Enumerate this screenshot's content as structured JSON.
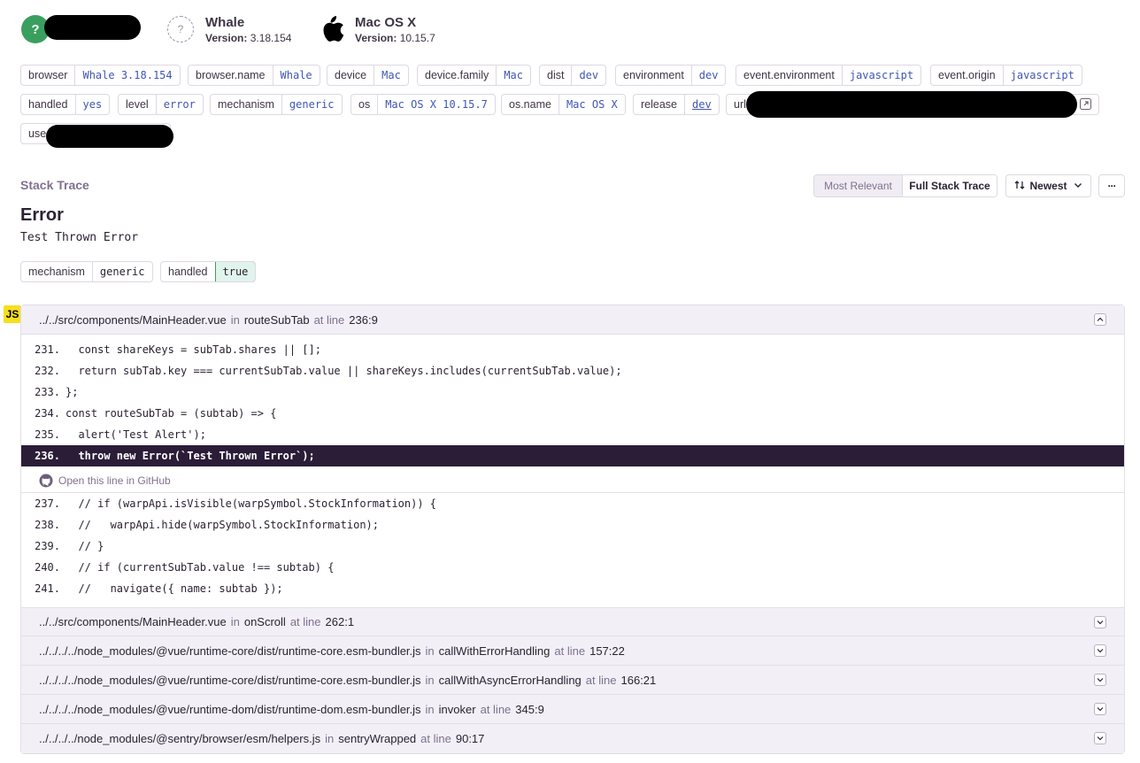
{
  "context": {
    "browser": {
      "title": "Whale",
      "version_label": "Version:",
      "version": "3.18.154"
    },
    "os": {
      "title": "Mac OS X",
      "version_label": "Version:",
      "version": "10.15.7"
    }
  },
  "tags": [
    {
      "key": "browser",
      "value": "Whale 3.18.154"
    },
    {
      "key": "browser.name",
      "value": "Whale"
    },
    {
      "key": "device",
      "value": "Mac"
    },
    {
      "key": "device.family",
      "value": "Mac"
    },
    {
      "key": "dist",
      "value": "dev"
    },
    {
      "key": "environment",
      "value": "dev"
    },
    {
      "key": "event.environment",
      "value": "javascript"
    },
    {
      "key": "event.origin",
      "value": "javascript"
    },
    {
      "key": "handled",
      "value": "yes"
    },
    {
      "key": "level",
      "value": "error"
    },
    {
      "key": "mechanism",
      "value": "generic"
    },
    {
      "key": "os",
      "value": "Mac OS X 10.15.7"
    },
    {
      "key": "os.name",
      "value": "Mac OS X"
    },
    {
      "key": "release",
      "value": "dev"
    },
    {
      "key": "url",
      "value": ""
    },
    {
      "key": "use",
      "value": ""
    }
  ],
  "stack": {
    "title": "Stack Trace",
    "toggle": {
      "relevant": "Most Relevant",
      "full": "Full Stack Trace"
    },
    "sort_label": "Newest",
    "more_label": "···"
  },
  "error": {
    "type": "Error",
    "message": "Test Thrown Error",
    "badges": [
      {
        "key": "mechanism",
        "value": "generic"
      },
      {
        "key": "handled",
        "value": "true"
      }
    ]
  },
  "platform_badge": "JS",
  "frames": [
    {
      "file": "../../src/components/MainHeader.vue",
      "in": "in",
      "fn": "routeSubTab",
      "at": "at line",
      "line": "236:9"
    },
    {
      "file": "../../src/components/MainHeader.vue",
      "in": "in",
      "fn": "onScroll",
      "at": "at line",
      "line": "262:1"
    },
    {
      "file": "../../../../node_modules/@vue/runtime-core/dist/runtime-core.esm-bundler.js",
      "in": "in",
      "fn": "callWithErrorHandling",
      "at": "at line",
      "line": "157:22"
    },
    {
      "file": "../../../../node_modules/@vue/runtime-core/dist/runtime-core.esm-bundler.js",
      "in": "in",
      "fn": "callWithAsyncErrorHandling",
      "at": "at line",
      "line": "166:21"
    },
    {
      "file": "../../../../node_modules/@vue/runtime-dom/dist/runtime-dom.esm-bundler.js",
      "in": "in",
      "fn": "invoker",
      "at": "at line",
      "line": "345:9"
    },
    {
      "file": "../../../../node_modules/@sentry/browser/esm/helpers.js",
      "in": "in",
      "fn": "sentryWrapped",
      "at": "at line",
      "line": "90:17"
    }
  ],
  "code": [
    {
      "ln": "231.",
      "text": "  const shareKeys = subTab.shares || [];"
    },
    {
      "ln": "232.",
      "text": "  return subTab.key === currentSubTab.value || shareKeys.includes(currentSubTab.value);"
    },
    {
      "ln": "233.",
      "text": "};"
    },
    {
      "ln": "234.",
      "text": "const routeSubTab = (subtab) => {"
    },
    {
      "ln": "235.",
      "text": "  alert('Test Alert');"
    },
    {
      "ln": "236.",
      "text": "  throw new Error(`Test Thrown Error`);"
    },
    {
      "ln": "237.",
      "text": "  // if (warpApi.isVisible(warpSymbol.StockInformation)) {"
    },
    {
      "ln": "238.",
      "text": "  //   warpApi.hide(warpSymbol.StockInformation);"
    },
    {
      "ln": "239.",
      "text": "  // }"
    },
    {
      "ln": "240.",
      "text": "  // if (currentSubTab.value !== subtab) {"
    },
    {
      "ln": "241.",
      "text": "  //   navigate({ name: subtab });"
    }
  ],
  "github_link": "Open this line in GitHub"
}
